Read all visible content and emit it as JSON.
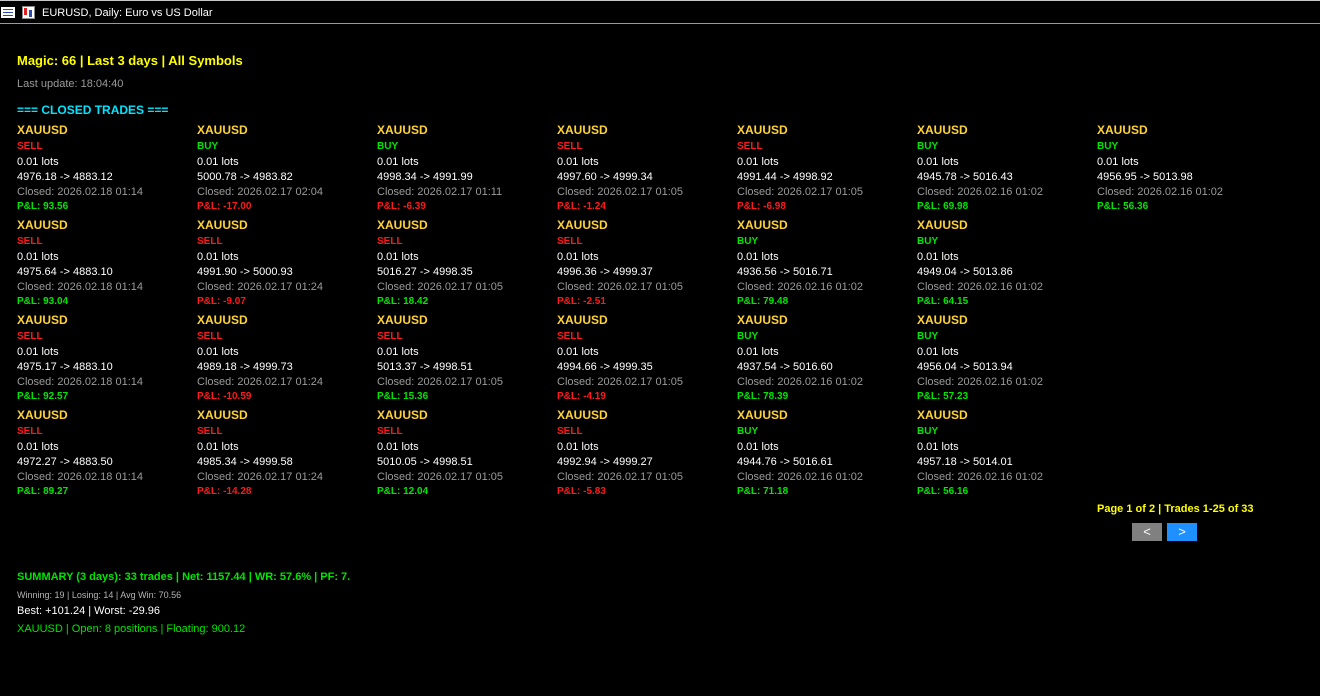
{
  "window": {
    "title": "EURUSD, Daily:  Euro vs US Dollar"
  },
  "header": {
    "title": "Magic: 66 | Last 3 days | All Symbols",
    "last_update": "Last update: 18:04:40"
  },
  "section_title": "=== CLOSED TRADES ===",
  "colors": {
    "sell": "#ff1a1a",
    "buy": "#00e600",
    "profit": "#00e600",
    "loss": "#ff1a1a",
    "symbol": "#ffd23a",
    "header": "#ffff00",
    "section": "#00e5ff"
  },
  "lots_label": "0.01 lots",
  "trades": [
    {
      "symbol": "XAUUSD",
      "side": "SELL",
      "lots": "0.01 lots",
      "prices": "4976.18 -> 4883.12",
      "closed": "Closed: 2026.02.18 01:14",
      "pnl": "P&L: 93.56"
    },
    {
      "symbol": "XAUUSD",
      "side": "SELL",
      "lots": "0.01 lots",
      "prices": "4975.64 -> 4883.10",
      "closed": "Closed: 2026.02.18 01:14",
      "pnl": "P&L: 93.04"
    },
    {
      "symbol": "XAUUSD",
      "side": "SELL",
      "lots": "0.01 lots",
      "prices": "4975.17 -> 4883.10",
      "closed": "Closed: 2026.02.18 01:14",
      "pnl": "P&L: 92.57"
    },
    {
      "symbol": "XAUUSD",
      "side": "SELL",
      "lots": "0.01 lots",
      "prices": "4972.27 -> 4883.50",
      "closed": "Closed: 2026.02.18 01:14",
      "pnl": "P&L: 89.27"
    },
    {
      "symbol": "XAUUSD",
      "side": "BUY",
      "lots": "0.01 lots",
      "prices": "5000.78 -> 4983.82",
      "closed": "Closed: 2026.02.17 02:04",
      "pnl": "P&L: -17.00"
    },
    {
      "symbol": "XAUUSD",
      "side": "SELL",
      "lots": "0.01 lots",
      "prices": "4991.90 -> 5000.93",
      "closed": "Closed: 2026.02.17 01:24",
      "pnl": "P&L: -9.07"
    },
    {
      "symbol": "XAUUSD",
      "side": "SELL",
      "lots": "0.01 lots",
      "prices": "4989.18 -> 4999.73",
      "closed": "Closed: 2026.02.17 01:24",
      "pnl": "P&L: -10.59"
    },
    {
      "symbol": "XAUUSD",
      "side": "SELL",
      "lots": "0.01 lots",
      "prices": "4985.34 -> 4999.58",
      "closed": "Closed: 2026.02.17 01:24",
      "pnl": "P&L: -14.28"
    },
    {
      "symbol": "XAUUSD",
      "side": "BUY",
      "lots": "0.01 lots",
      "prices": "4998.34 -> 4991.99",
      "closed": "Closed: 2026.02.17 01:11",
      "pnl": "P&L: -6.39"
    },
    {
      "symbol": "XAUUSD",
      "side": "SELL",
      "lots": "0.01 lots",
      "prices": "5016.27 -> 4998.35",
      "closed": "Closed: 2026.02.17 01:05",
      "pnl": "P&L: 18.42"
    },
    {
      "symbol": "XAUUSD",
      "side": "SELL",
      "lots": "0.01 lots",
      "prices": "5013.37 -> 4998.51",
      "closed": "Closed: 2026.02.17 01:05",
      "pnl": "P&L: 15.36"
    },
    {
      "symbol": "XAUUSD",
      "side": "SELL",
      "lots": "0.01 lots",
      "prices": "5010.05 -> 4998.51",
      "closed": "Closed: 2026.02.17 01:05",
      "pnl": "P&L: 12.04"
    },
    {
      "symbol": "XAUUSD",
      "side": "SELL",
      "lots": "0.01 lots",
      "prices": "4997.60 -> 4999.34",
      "closed": "Closed: 2026.02.17 01:05",
      "pnl": "P&L: -1.24"
    },
    {
      "symbol": "XAUUSD",
      "side": "SELL",
      "lots": "0.01 lots",
      "prices": "4996.36 -> 4999.37",
      "closed": "Closed: 2026.02.17 01:05",
      "pnl": "P&L: -2.51"
    },
    {
      "symbol": "XAUUSD",
      "side": "SELL",
      "lots": "0.01 lots",
      "prices": "4994.66 -> 4999.35",
      "closed": "Closed: 2026.02.17 01:05",
      "pnl": "P&L: -4.19"
    },
    {
      "symbol": "XAUUSD",
      "side": "SELL",
      "lots": "0.01 lots",
      "prices": "4992.94 -> 4999.27",
      "closed": "Closed: 2026.02.17 01:05",
      "pnl": "P&L: -5.83"
    },
    {
      "symbol": "XAUUSD",
      "side": "SELL",
      "lots": "0.01 lots",
      "prices": "4991.44 -> 4998.92",
      "closed": "Closed: 2026.02.17 01:05",
      "pnl": "P&L: -6.98"
    },
    {
      "symbol": "XAUUSD",
      "side": "BUY",
      "lots": "0.01 lots",
      "prices": "4936.56 -> 5016.71",
      "closed": "Closed: 2026.02.16 01:02",
      "pnl": "P&L: 79.48"
    },
    {
      "symbol": "XAUUSD",
      "side": "BUY",
      "lots": "0.01 lots",
      "prices": "4937.54 -> 5016.60",
      "closed": "Closed: 2026.02.16 01:02",
      "pnl": "P&L: 78.39"
    },
    {
      "symbol": "XAUUSD",
      "side": "BUY",
      "lots": "0.01 lots",
      "prices": "4944.76 -> 5016.61",
      "closed": "Closed: 2026.02.16 01:02",
      "pnl": "P&L: 71.18"
    },
    {
      "symbol": "XAUUSD",
      "side": "BUY",
      "lots": "0.01 lots",
      "prices": "4945.78 -> 5016.43",
      "closed": "Closed: 2026.02.16 01:02",
      "pnl": "P&L: 69.98"
    },
    {
      "symbol": "XAUUSD",
      "side": "BUY",
      "lots": "0.01 lots",
      "prices": "4949.04 -> 5013.86",
      "closed": "Closed: 2026.02.16 01:02",
      "pnl": "P&L: 64.15"
    },
    {
      "symbol": "XAUUSD",
      "side": "BUY",
      "lots": "0.01 lots",
      "prices": "4956.04 -> 5013.94",
      "closed": "Closed: 2026.02.16 01:02",
      "pnl": "P&L: 57.23"
    },
    {
      "symbol": "XAUUSD",
      "side": "BUY",
      "lots": "0.01 lots",
      "prices": "4957.18 -> 5014.01",
      "closed": "Closed: 2026.02.16 01:02",
      "pnl": "P&L: 56.16"
    },
    {
      "symbol": "XAUUSD",
      "side": "BUY",
      "lots": "0.01 lots",
      "prices": "4956.95 -> 5013.98",
      "closed": "Closed: 2026.02.16 01:02",
      "pnl": "P&L: 56.36"
    }
  ],
  "pagination": {
    "info": "Page 1 of 2 | Trades 1-25 of 33",
    "prev_label": "<",
    "next_label": ">"
  },
  "summary": {
    "line": "SUMMARY (3 days): 33 trades | Net: 1157.44 | WR: 57.6% | PF: 7.",
    "winloss": "Winning: 19 | Losing: 14 | Avg Win: 70.56",
    "bestworst": "Best: +101.24 | Worst: -29.96",
    "open_positions": "XAUUSD | Open: 8 positions | Floating: 900.12"
  },
  "icons": [
    "chart-window-icon",
    "chart-type-icon"
  ]
}
